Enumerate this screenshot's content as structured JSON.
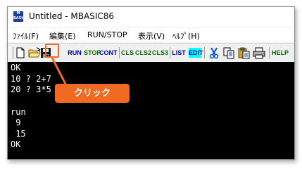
{
  "window": {
    "title": "Untitled - MBASIC86",
    "icon_text_line1": "M",
    "icon_text_line2": "BASIC"
  },
  "menu": {
    "items": [
      {
        "label": "ﾌｧｲﾙ(F)"
      },
      {
        "label": "編集(E)"
      },
      {
        "label": "RUN/STOP"
      },
      {
        "label": "表示(V)"
      },
      {
        "label": "ﾍﾙﾌﾟ(H)"
      }
    ]
  },
  "toolbar": {
    "new_icon": "new-file-icon",
    "open_icon": "open-folder-icon",
    "save_icon": "save-disk-icon",
    "run_label": "RUN",
    "stop_label": "STOP",
    "cont_label": "CONT",
    "cls_label": "CLS",
    "cls2_label": "CLS2",
    "cls3_label": "CLS3",
    "list_label": "LIST",
    "edit_label": "EDIT",
    "cut_icon": "scissors-icon",
    "copy_icon": "copy-icon",
    "paste_icon": "paste-icon",
    "print_icon": "printer-icon",
    "help_label": "HELP"
  },
  "console": {
    "lines": [
      "OK",
      "10 ? 2+7",
      "20 ? 3*5",
      "",
      "run",
      " 9",
      " 15",
      "OK"
    ]
  },
  "annotation": {
    "callout_text": "クリック",
    "accent_color": "#f26a21"
  }
}
